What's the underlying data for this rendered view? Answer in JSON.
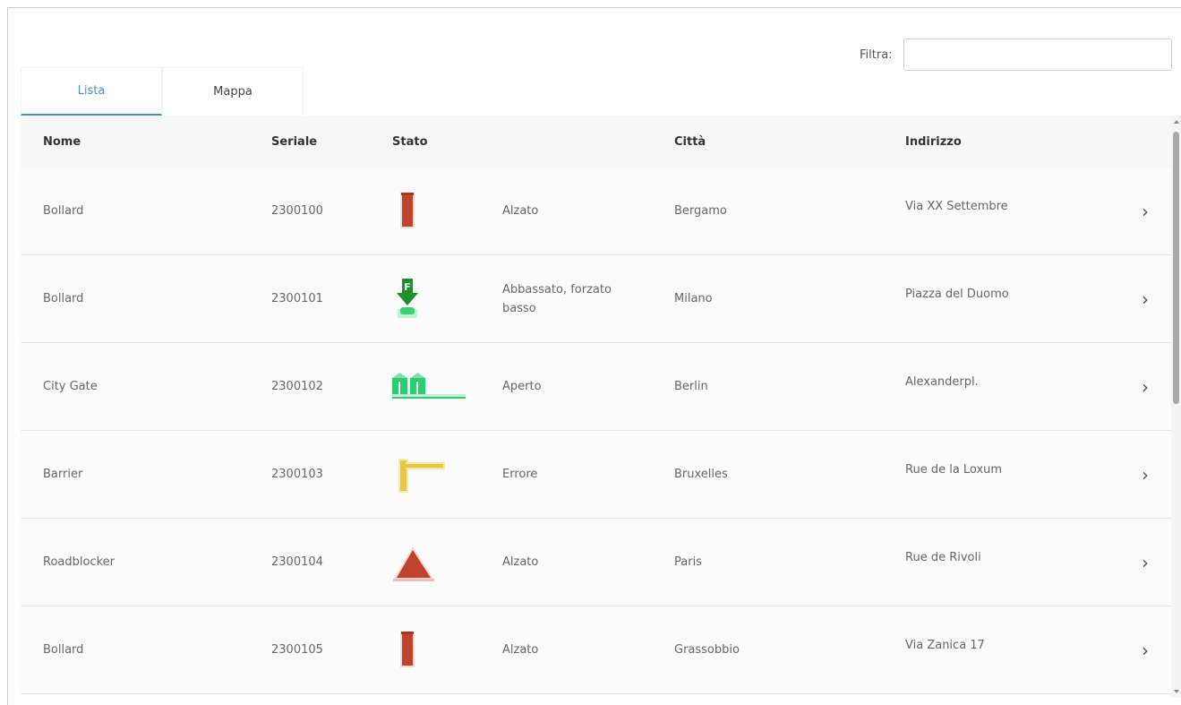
{
  "filter": {
    "label": "Filtra:",
    "value": "",
    "placeholder": ""
  },
  "tabs": [
    {
      "label": "Lista",
      "active": true
    },
    {
      "label": "Mappa",
      "active": false
    }
  ],
  "table": {
    "headers": {
      "nome": "Nome",
      "seriale": "Seriale",
      "stato": "Stato",
      "citta": "Città",
      "indirizzo": "Indirizzo"
    },
    "rows": [
      {
        "nome": "Bollard",
        "seriale": "2300100",
        "icon": "bollard-raised-icon",
        "stato": "Alzato",
        "citta": "Bergamo",
        "indirizzo": "Via XX Settembre"
      },
      {
        "nome": "Bollard",
        "seriale": "2300101",
        "icon": "bollard-forced-down-icon",
        "stato": "Abbassato, forzato basso",
        "citta": "Milano",
        "indirizzo": "Piazza del Duomo"
      },
      {
        "nome": "City Gate",
        "seriale": "2300102",
        "icon": "city-gate-open-icon",
        "stato": "Aperto",
        "citta": "Berlin",
        "indirizzo": "Alexanderpl."
      },
      {
        "nome": "Barrier",
        "seriale": "2300103",
        "icon": "barrier-error-icon",
        "stato": "Errore",
        "citta": "Bruxelles",
        "indirizzo": "Rue de la Loxum"
      },
      {
        "nome": "Roadblocker",
        "seriale": "2300104",
        "icon": "roadblocker-raised-icon",
        "stato": "Alzato",
        "citta": "Paris",
        "indirizzo": "Rue de Rivoli"
      },
      {
        "nome": "Bollard",
        "seriale": "2300105",
        "icon": "bollard-raised-icon",
        "stato": "Alzato",
        "citta": "Grassobbio",
        "indirizzo": "Via Zanica 17"
      }
    ]
  },
  "colors": {
    "accent": "#4a90c2",
    "raised": "#c0432c",
    "open": "#2ecc71",
    "forced": "#1e8f2f",
    "error": "#e8c840"
  }
}
